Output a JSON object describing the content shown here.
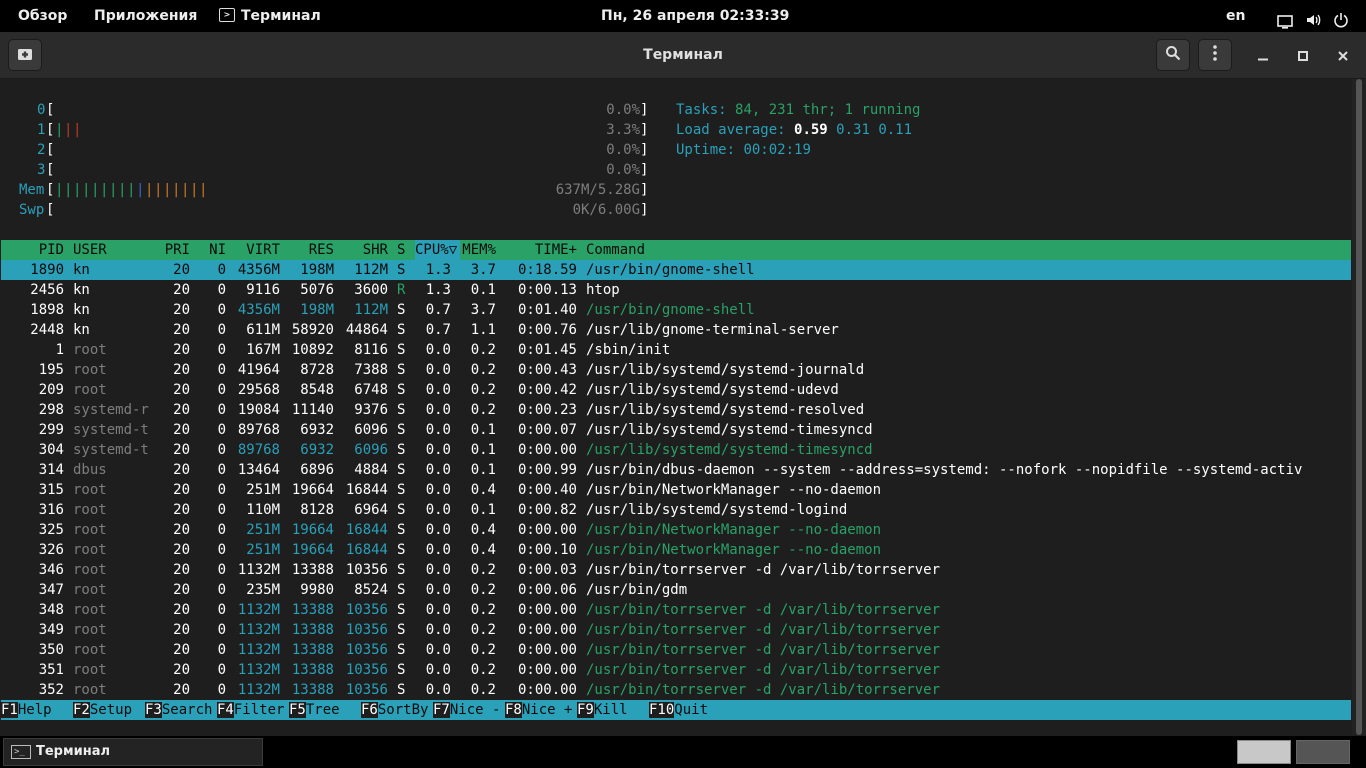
{
  "topbar": {
    "overview": "Обзор",
    "apps": "Приложения",
    "active_app": "Терминал",
    "clock": "Пн, 26 апреля  02:33:39",
    "lang": "en"
  },
  "window": {
    "title": "Терминал"
  },
  "meters": {
    "cpus": [
      {
        "label": "0",
        "bars": [],
        "value": "0.0%"
      },
      {
        "label": "1",
        "bars": [
          "green",
          "red",
          "red"
        ],
        "value": "3.3%"
      },
      {
        "label": "2",
        "bars": [],
        "value": "0.0%"
      },
      {
        "label": "3",
        "bars": [],
        "value": "0.0%"
      }
    ],
    "mem": {
      "label": "Mem",
      "bars": [
        "green",
        "green",
        "green",
        "green",
        "green",
        "green",
        "green",
        "green",
        "green",
        "blue",
        "orange",
        "orange",
        "orange",
        "orange",
        "orange",
        "orange",
        "orange"
      ],
      "value": "637M/5.28G"
    },
    "swp": {
      "label": "Swp",
      "bars": [],
      "value": "0K/6.00G"
    }
  },
  "summary": {
    "tasks_label": "Tasks: ",
    "tasks_value": "84, 231 thr; 1 running",
    "load_label": "Load average: ",
    "load_1": "0.59",
    "load_5": "0.31",
    "load_15": "0.11",
    "uptime_label": "Uptime: ",
    "uptime_value": "00:02:19"
  },
  "table": {
    "columns": [
      "PID",
      "USER",
      "PRI",
      "NI",
      "VIRT",
      "RES",
      "SHR",
      "S",
      "CPU%▽",
      "MEM%",
      "TIME+",
      "Command"
    ],
    "rows": [
      [
        "1890",
        "kn",
        "20",
        "0",
        "4356M",
        "198M",
        "112M",
        "S",
        "1.3",
        "3.7",
        "0:18.59",
        "/usr/bin/gnome-shell",
        "sel"
      ],
      [
        "2456",
        "kn",
        "20",
        "0",
        "9116",
        "5076",
        "3600",
        "R",
        "1.3",
        "0.1",
        "0:00.13",
        "htop",
        "proc"
      ],
      [
        "1898",
        "kn",
        "20",
        "0",
        "4356M",
        "198M",
        "112M",
        "S",
        "0.7",
        "3.7",
        "0:01.40",
        "/usr/bin/gnome-shell",
        "thread"
      ],
      [
        "2448",
        "kn",
        "20",
        "0",
        "611M",
        "58920",
        "44864",
        "S",
        "0.7",
        "1.1",
        "0:00.76",
        "/usr/lib/gnome-terminal-server",
        "proc"
      ],
      [
        "1",
        "root",
        "20",
        "0",
        "167M",
        "10892",
        "8116",
        "S",
        "0.0",
        "0.2",
        "0:01.45",
        "/sbin/init",
        "proc"
      ],
      [
        "195",
        "root",
        "20",
        "0",
        "41964",
        "8728",
        "7388",
        "S",
        "0.0",
        "0.2",
        "0:00.43",
        "/usr/lib/systemd/systemd-journald",
        "proc"
      ],
      [
        "209",
        "root",
        "20",
        "0",
        "29568",
        "8548",
        "6748",
        "S",
        "0.0",
        "0.2",
        "0:00.42",
        "/usr/lib/systemd/systemd-udevd",
        "proc"
      ],
      [
        "298",
        "systemd-r",
        "20",
        "0",
        "19084",
        "11140",
        "9376",
        "S",
        "0.0",
        "0.2",
        "0:00.23",
        "/usr/lib/systemd/systemd-resolved",
        "proc"
      ],
      [
        "299",
        "systemd-t",
        "20",
        "0",
        "89768",
        "6932",
        "6096",
        "S",
        "0.0",
        "0.1",
        "0:00.07",
        "/usr/lib/systemd/systemd-timesyncd",
        "proc"
      ],
      [
        "304",
        "systemd-t",
        "20",
        "0",
        "89768",
        "6932",
        "6096",
        "S",
        "0.0",
        "0.1",
        "0:00.00",
        "/usr/lib/systemd/systemd-timesyncd",
        "thread"
      ],
      [
        "314",
        "dbus",
        "20",
        "0",
        "13464",
        "6896",
        "4884",
        "S",
        "0.0",
        "0.1",
        "0:00.99",
        "/usr/bin/dbus-daemon --system --address=systemd: --nofork --nopidfile --systemd-activ",
        "proc"
      ],
      [
        "315",
        "root",
        "20",
        "0",
        "251M",
        "19664",
        "16844",
        "S",
        "0.0",
        "0.4",
        "0:00.40",
        "/usr/bin/NetworkManager --no-daemon",
        "proc"
      ],
      [
        "316",
        "root",
        "20",
        "0",
        "110M",
        "8128",
        "6964",
        "S",
        "0.0",
        "0.1",
        "0:00.82",
        "/usr/lib/systemd/systemd-logind",
        "proc"
      ],
      [
        "325",
        "root",
        "20",
        "0",
        "251M",
        "19664",
        "16844",
        "S",
        "0.0",
        "0.4",
        "0:00.00",
        "/usr/bin/NetworkManager --no-daemon",
        "thread"
      ],
      [
        "326",
        "root",
        "20",
        "0",
        "251M",
        "19664",
        "16844",
        "S",
        "0.0",
        "0.4",
        "0:00.10",
        "/usr/bin/NetworkManager --no-daemon",
        "thread"
      ],
      [
        "346",
        "root",
        "20",
        "0",
        "1132M",
        "13388",
        "10356",
        "S",
        "0.0",
        "0.2",
        "0:00.03",
        "/usr/bin/torrserver -d /var/lib/torrserver",
        "proc"
      ],
      [
        "347",
        "root",
        "20",
        "0",
        "235M",
        "9980",
        "8524",
        "S",
        "0.0",
        "0.2",
        "0:00.06",
        "/usr/bin/gdm",
        "proc"
      ],
      [
        "348",
        "root",
        "20",
        "0",
        "1132M",
        "13388",
        "10356",
        "S",
        "0.0",
        "0.2",
        "0:00.00",
        "/usr/bin/torrserver -d /var/lib/torrserver",
        "thread"
      ],
      [
        "349",
        "root",
        "20",
        "0",
        "1132M",
        "13388",
        "10356",
        "S",
        "0.0",
        "0.2",
        "0:00.00",
        "/usr/bin/torrserver -d /var/lib/torrserver",
        "thread"
      ],
      [
        "350",
        "root",
        "20",
        "0",
        "1132M",
        "13388",
        "10356",
        "S",
        "0.0",
        "0.2",
        "0:00.00",
        "/usr/bin/torrserver -d /var/lib/torrserver",
        "thread"
      ],
      [
        "351",
        "root",
        "20",
        "0",
        "1132M",
        "13388",
        "10356",
        "S",
        "0.0",
        "0.2",
        "0:00.00",
        "/usr/bin/torrserver -d /var/lib/torrserver",
        "thread"
      ],
      [
        "352",
        "root",
        "20",
        "0",
        "1132M",
        "13388",
        "10356",
        "S",
        "0.0",
        "0.2",
        "0:00.00",
        "/usr/bin/torrserver -d /var/lib/torrserver",
        "thread"
      ]
    ]
  },
  "fkeys": [
    {
      "key": "F1",
      "label": "Help  "
    },
    {
      "key": "F2",
      "label": "Setup "
    },
    {
      "key": "F3",
      "label": "Search"
    },
    {
      "key": "F4",
      "label": "Filter"
    },
    {
      "key": "F5",
      "label": "Tree  "
    },
    {
      "key": "F6",
      "label": "SortBy"
    },
    {
      "key": "F7",
      "label": "Nice -"
    },
    {
      "key": "F8",
      "label": "Nice +"
    },
    {
      "key": "F9",
      "label": "Kill  "
    },
    {
      "key": "F10",
      "label": "Quit"
    }
  ],
  "taskbar": {
    "item": "Терминал"
  },
  "colors": {
    "header_green": "#2aa167",
    "selection_teal": "#2aa0b9",
    "background": "#1e1e1e"
  }
}
